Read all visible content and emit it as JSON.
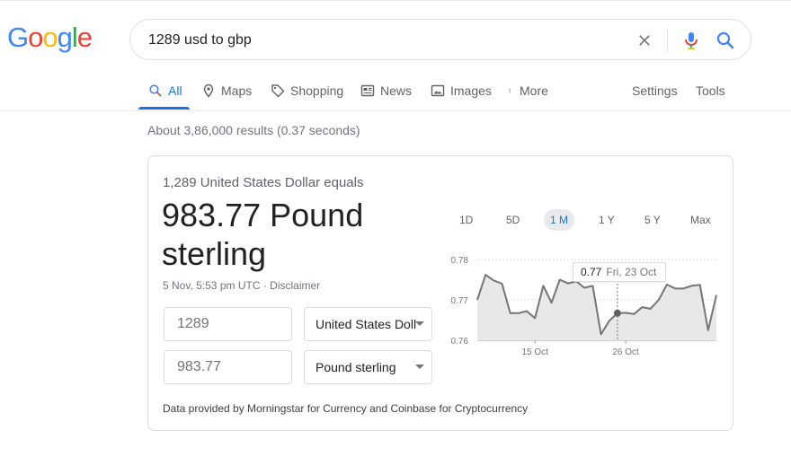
{
  "logo": {
    "letters": [
      "G",
      "o",
      "o",
      "g",
      "l",
      "e"
    ],
    "colors": [
      "#4285f4",
      "#ea4335",
      "#fbbc05",
      "#4285f4",
      "#34a853",
      "#ea4335"
    ]
  },
  "search": {
    "query": "1289 usd to gbp"
  },
  "tabs": [
    {
      "label": "All",
      "icon": "search-icon"
    },
    {
      "label": "Maps",
      "icon": "map-pin-icon"
    },
    {
      "label": "Shopping",
      "icon": "tag-icon"
    },
    {
      "label": "News",
      "icon": "newspaper-icon"
    },
    {
      "label": "Images",
      "icon": "image-icon"
    },
    {
      "label": "More",
      "icon": "more-vert-icon"
    }
  ],
  "tools": {
    "settings": "Settings",
    "tools": "Tools"
  },
  "result_stats": "About 3,86,000 results (0.37 seconds)",
  "converter": {
    "equals_line": "1,289 United States Dollar equals",
    "result_line1": "983.77 Pound",
    "result_line2": "sterling",
    "timestamp": "5 Nov, 5:53 pm UTC",
    "separator": "·",
    "disclaimer": "Disclaimer",
    "from_amount": "1289",
    "from_currency": "United States Dollar",
    "to_amount": "983.77",
    "to_currency": "Pound sterling",
    "footer": "Data provided by Morningstar for Currency and Coinbase for Cryptocurrency"
  },
  "chart_ranges": [
    "1D",
    "5D",
    "1 M",
    "1 Y",
    "5 Y",
    "Max"
  ],
  "chart_tooltip": {
    "value": "0.77",
    "date": "Fri, 23 Oct"
  },
  "colors": {
    "accent": "#1a73e8",
    "chart_line": "#757575",
    "chart_fill": "#e8e8e8"
  },
  "chart_data": {
    "type": "area",
    "title": "",
    "xlabel": "",
    "ylabel": "",
    "ylim": [
      0.76,
      0.78
    ],
    "yticks": [
      "0.78",
      "0.77",
      "0.76"
    ],
    "xticks": [
      "15 Oct",
      "26 Oct"
    ],
    "active_range": "1 M",
    "values": [
      0.77,
      0.7762,
      0.7748,
      0.774,
      0.7667,
      0.7667,
      0.7672,
      0.7655,
      0.7735,
      0.7693,
      0.775,
      0.7741,
      0.7746,
      0.773,
      0.7735,
      0.7615,
      0.7648,
      0.7667,
      0.7668,
      0.7665,
      0.7682,
      0.7678,
      0.77,
      0.7738,
      0.7728,
      0.7728,
      0.7735,
      0.7737,
      0.7625,
      0.7712
    ],
    "highlight_index": 17
  }
}
